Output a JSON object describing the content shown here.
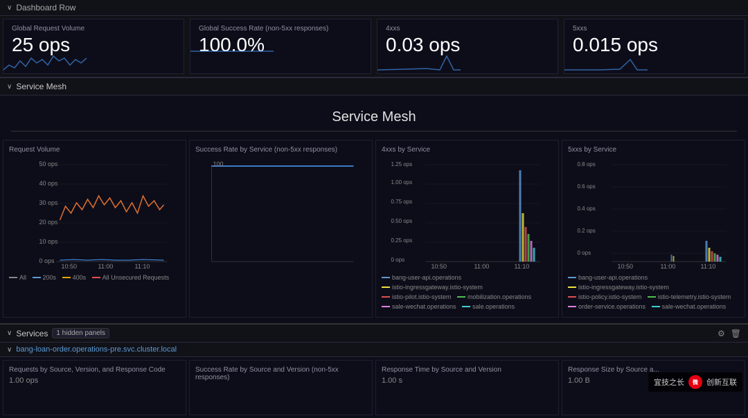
{
  "dashboard_row": {
    "label": "Dashboard Row",
    "chevron": "∨"
  },
  "metrics": [
    {
      "title": "Global Request Volume",
      "value": "25 ops",
      "color": "#4a9eff"
    },
    {
      "title": "Global Success Rate (non-5xx responses)",
      "value": "100.0%",
      "color": "#4a9eff"
    },
    {
      "title": "4xxs",
      "value": "0.03 ops",
      "color": "#4a9eff"
    },
    {
      "title": "5xxs",
      "value": "0.015 ops",
      "color": "#4a9eff"
    }
  ],
  "service_mesh_section": {
    "label": "Service Mesh",
    "title": "Service Mesh",
    "chevron": "∨"
  },
  "charts": [
    {
      "title": "Request Volume",
      "type": "line",
      "legend": [
        {
          "label": "All",
          "color": "#888"
        },
        {
          "label": "200s",
          "color": "#5b9bd5"
        },
        {
          "label": "400s",
          "color": "#f0a500"
        },
        {
          "label": "All Unsecured Requests",
          "color": "#e05050"
        }
      ],
      "y_labels": [
        "50 ops",
        "40 ops",
        "30 ops",
        "20 ops",
        "10 ops",
        "0 ops"
      ],
      "x_labels": [
        "10:50",
        "11:00",
        "11:10"
      ]
    },
    {
      "title": "Success Rate by Service (non-5xx responses)",
      "type": "line",
      "legend": [],
      "y_labels": [],
      "x_labels": []
    },
    {
      "title": "4xxs by Service",
      "type": "bar",
      "legend": [
        {
          "label": "bang-user-api.operations",
          "color": "#5b9bd5"
        },
        {
          "label": "istio-ingressgateway.istio-system",
          "color": "#f0e040"
        },
        {
          "label": "istio-pilot.istio-system",
          "color": "#e05050"
        },
        {
          "label": "mobilization.operations",
          "color": "#50c050"
        },
        {
          "label": "sale-wechat.operations",
          "color": "#e080e0"
        },
        {
          "label": "sale.operations",
          "color": "#40d0d0"
        }
      ],
      "y_labels": [
        "1.25 ops",
        "1.00 ops",
        "0.75 ops",
        "0.50 ops",
        "0.25 ops",
        "0 ops"
      ],
      "x_labels": [
        "10:50",
        "11:00",
        "11:10"
      ]
    },
    {
      "title": "5xxs by Service",
      "type": "bar",
      "legend": [
        {
          "label": "bang-user-api.operations",
          "color": "#5b9bd5"
        },
        {
          "label": "istio-ingressgateway.istio-system",
          "color": "#f0e040"
        },
        {
          "label": "istio-policy.istio-system",
          "color": "#e05050"
        },
        {
          "label": "istio-telemetry.istio-system",
          "color": "#50c050"
        },
        {
          "label": "order-service.operations",
          "color": "#e080e0"
        },
        {
          "label": "sale-wechat.operations",
          "color": "#40d0d0"
        }
      ],
      "y_labels": [
        "0.8 ops",
        "0.6 ops",
        "0.4 ops",
        "0.2 ops",
        "0 ops"
      ],
      "x_labels": [
        "10:50",
        "11:00",
        "11:10"
      ]
    }
  ],
  "services_section": {
    "label": "Services",
    "badge": "1 hidden panels",
    "chevron": "∨"
  },
  "service_instance": {
    "label": "bang-loan-order.operations-pre.svc.cluster.local",
    "chevron": "∨"
  },
  "bottom_charts": [
    {
      "title": "Requests by Source, Version, and Response Code",
      "value": "1.00 ops"
    },
    {
      "title": "Success Rate by Source and Version (non-5xx responses)",
      "value": ""
    },
    {
      "title": "Response Time by Source and Version",
      "value": "1.00 s"
    },
    {
      "title": "Response Size by Source a...",
      "value": "1.00 B"
    }
  ],
  "watermark": {
    "text1": "宜技之长",
    "text2": "创新互联"
  }
}
